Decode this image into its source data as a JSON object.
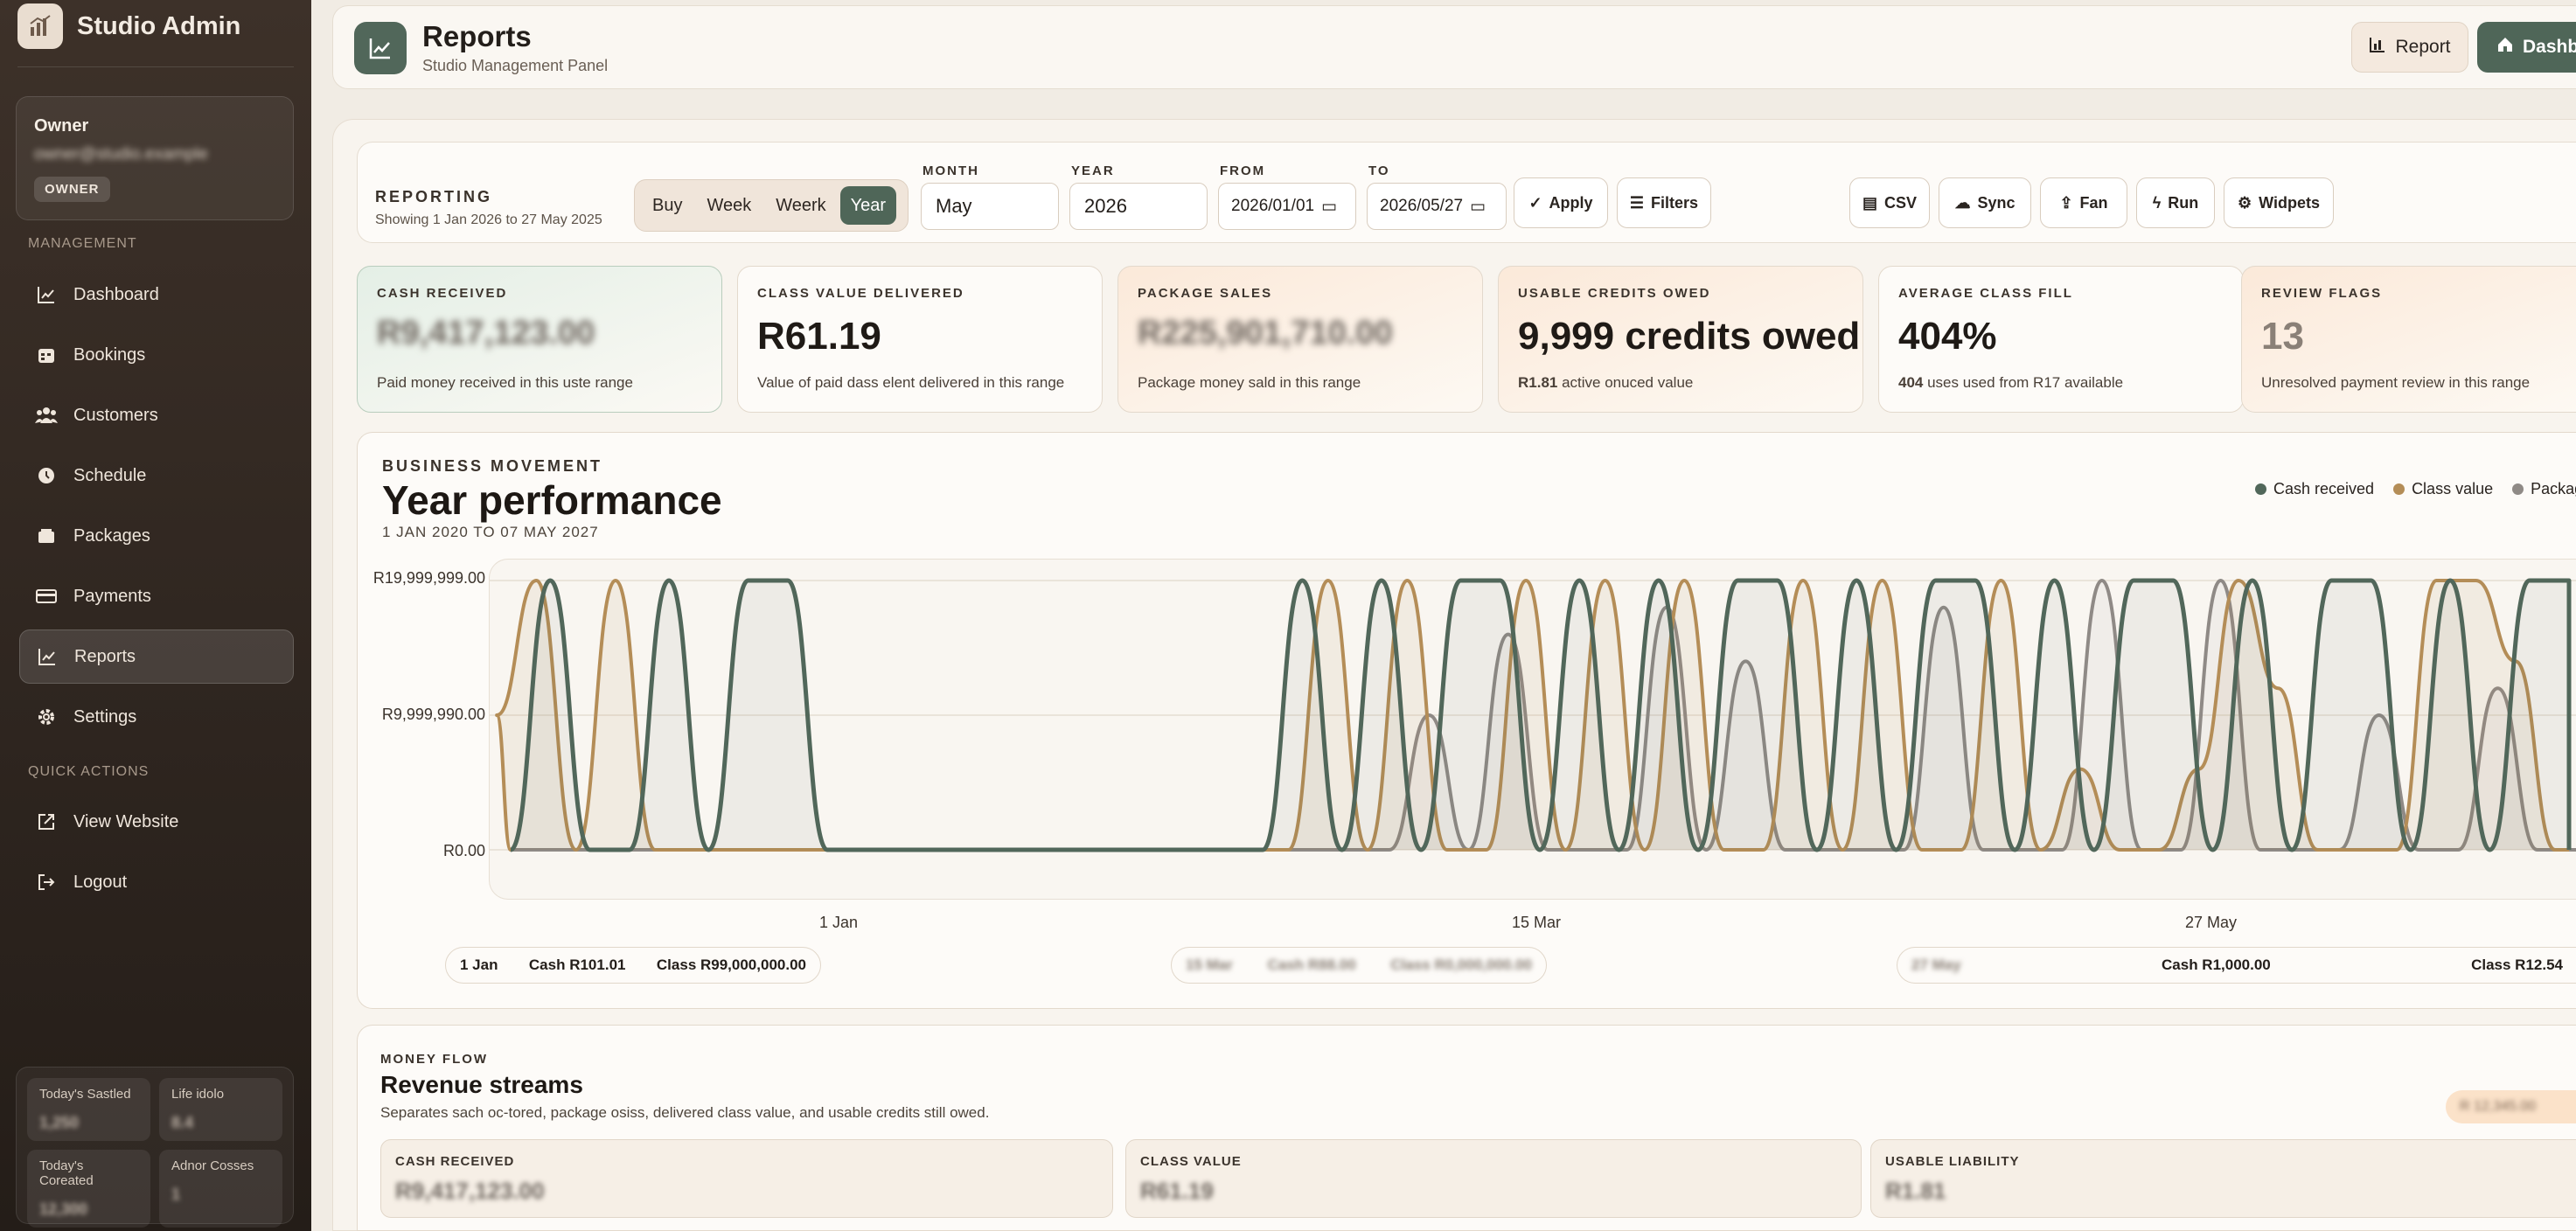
{
  "app": {
    "brand": "Studio Admin"
  },
  "owner": {
    "title": "Owner",
    "email": "owner@studio.example",
    "badge": "OWNER"
  },
  "nav": {
    "management_label": "MANAGEMENT",
    "items": [
      {
        "label": "Dashboard",
        "icon": "dashboard-icon"
      },
      {
        "label": "Bookings",
        "icon": "calendar-icon"
      },
      {
        "label": "Customers",
        "icon": "users-icon"
      },
      {
        "label": "Schedule",
        "icon": "clock-icon"
      },
      {
        "label": "Packages",
        "icon": "package-icon"
      },
      {
        "label": "Payments",
        "icon": "card-icon"
      },
      {
        "label": "Reports",
        "icon": "chart-line-icon",
        "active": true
      },
      {
        "label": "Settings",
        "icon": "gear-icon"
      }
    ],
    "quick_label": "QUICK ACTIONS",
    "quick_items": [
      {
        "label": "View Website",
        "icon": "external-link-icon"
      },
      {
        "label": "Logout",
        "icon": "logout-icon"
      }
    ]
  },
  "sidebar_stats": [
    {
      "label": "Today's Sastled",
      "value": "1,250"
    },
    {
      "label": "Life idolo",
      "value": "8.4"
    },
    {
      "label": "Today's Coreated",
      "value": "12,300"
    },
    {
      "label": "Adnor Cosses",
      "value": "1"
    }
  ],
  "header": {
    "title": "Reports",
    "subtitle": "Studio Management Panel",
    "report_btn": "Report",
    "dashboard_btn": "Dashboard"
  },
  "toolbar": {
    "title": "REPORTING",
    "subtitle": "Showing 1 Jan 2026 to 27 May 2025",
    "segments": [
      "Buy",
      "Week",
      "Weerk",
      "Year"
    ],
    "selected_segment": "Year",
    "month_label": "MONTH",
    "month_value": "May",
    "year_label": "YEAR",
    "year_value": "2026",
    "from_label": "FROM",
    "from_value": "2026/01/01",
    "to_label": "TO",
    "to_value": "2026/05/27",
    "apply": "Apply",
    "filters": "Filters",
    "actions": [
      "CSV",
      "Sync",
      "Fan",
      "Run",
      "Widpets"
    ]
  },
  "kpis": [
    {
      "label": "CASH RECEIVED",
      "value": "R9,417,123.00",
      "desc": "Paid money received in this uste range",
      "blur": true
    },
    {
      "label": "CLASS VALUE DELIVERED",
      "value": "R61.19",
      "desc": "Value of paid dass elent delivered in this range"
    },
    {
      "label": "PACKAGE SALES",
      "value": "R225,901,710.00",
      "desc": "Package money sald in this range",
      "blur": true
    },
    {
      "label": "USABLE CREDITS OWED",
      "value": "9,999 credits owed",
      "desc_strong": "R1.81",
      "desc": " active onuced value"
    },
    {
      "label": "AVERAGE CLASS FILL",
      "value": "404%",
      "desc_strong": "404",
      "desc": " uses used from R17 available"
    },
    {
      "label": "REVIEW FLAGS",
      "value": "13",
      "desc": "Unresolved payment review in this range"
    }
  ],
  "chart": {
    "kicker": "BUSINESS MOVEMENT",
    "title": "Year performance",
    "range": "1 JAN 2020 TO 07 MAY 2027",
    "yticks": [
      "R19,999,999.00",
      "R9,999,990.00",
      "R0.00"
    ],
    "xticks": [
      "1 Jan",
      "15 Mar",
      "27 May"
    ],
    "colors": {
      "cash": "#51675a",
      "class": "#b48d57",
      "package": "#8f8a86"
    }
  },
  "chart_data": {
    "type": "line",
    "ylim": [
      0,
      20000000
    ],
    "xticks": [
      "1 Jan",
      "15 Mar",
      "27 May"
    ],
    "series": [
      {
        "name": "Cash received",
        "peaks": [
          0,
          1,
          0,
          0,
          1,
          0,
          1,
          1,
          0,
          0,
          0,
          0,
          0,
          0,
          0,
          0,
          0,
          0,
          0,
          0,
          1,
          0,
          1,
          0,
          1,
          1,
          0,
          1,
          0,
          1,
          0,
          1,
          1,
          0,
          1,
          0,
          1,
          1,
          0,
          1,
          0,
          1,
          1,
          0,
          1,
          0,
          1,
          1,
          0,
          1,
          0,
          1,
          1
        ]
      },
      {
        "name": "Class value",
        "peaks": [
          0.5,
          1,
          0,
          1,
          0,
          0,
          0,
          0,
          0,
          0,
          0,
          0,
          0,
          0,
          0,
          0,
          0,
          0,
          0,
          0,
          0,
          1,
          0,
          1,
          0,
          0,
          1,
          0,
          1,
          0,
          1,
          0,
          0,
          1,
          0,
          1,
          0,
          0,
          1,
          0,
          0.3,
          0,
          0,
          0.3,
          1,
          0.6,
          0,
          0,
          0,
          1,
          1,
          0.7,
          0
        ]
      },
      {
        "name": "Package value",
        "peaks": [
          0,
          0,
          0,
          0,
          0,
          0,
          0,
          0,
          0,
          0,
          0,
          0,
          0,
          0,
          0,
          0,
          0,
          0,
          0,
          0,
          0,
          0,
          0,
          0.5,
          0,
          0.8,
          0,
          0,
          0,
          0.9,
          0,
          0.7,
          0,
          0,
          0,
          0,
          0.9,
          0,
          0,
          0,
          1,
          0,
          0,
          1,
          0,
          0,
          0,
          0.5,
          0,
          0,
          0.6,
          0,
          0
        ]
      }
    ],
    "legend": [
      "Cash received",
      "Class value",
      "Package value"
    ]
  },
  "summary_pills": [
    {
      "date": "1 Jan",
      "cash": "Cash R101.01",
      "class": "Class R99,000,000.00"
    },
    {
      "date": "15 Mar",
      "cash": "Cash R88.00",
      "class": "Class R0,000,000.00",
      "blur": true
    },
    {
      "date": "27 May",
      "cash": "Cash R1,000.00",
      "class": "Class R12.54"
    }
  ],
  "flow": {
    "kicker": "MONEY FLOW",
    "title": "Revenue streams",
    "desc": "Separates sach oc-tored, package osiss, delivered class value, and usable credits still owed.",
    "pill": "R 12,345.00",
    "boxes": [
      {
        "label": "CASH RECEIVED",
        "value": "R9,417,123.00"
      },
      {
        "label": "CLASS VALUE",
        "value": "R61.19"
      },
      {
        "label": "USABLE LIABILITY",
        "value": "R1.81"
      }
    ]
  }
}
